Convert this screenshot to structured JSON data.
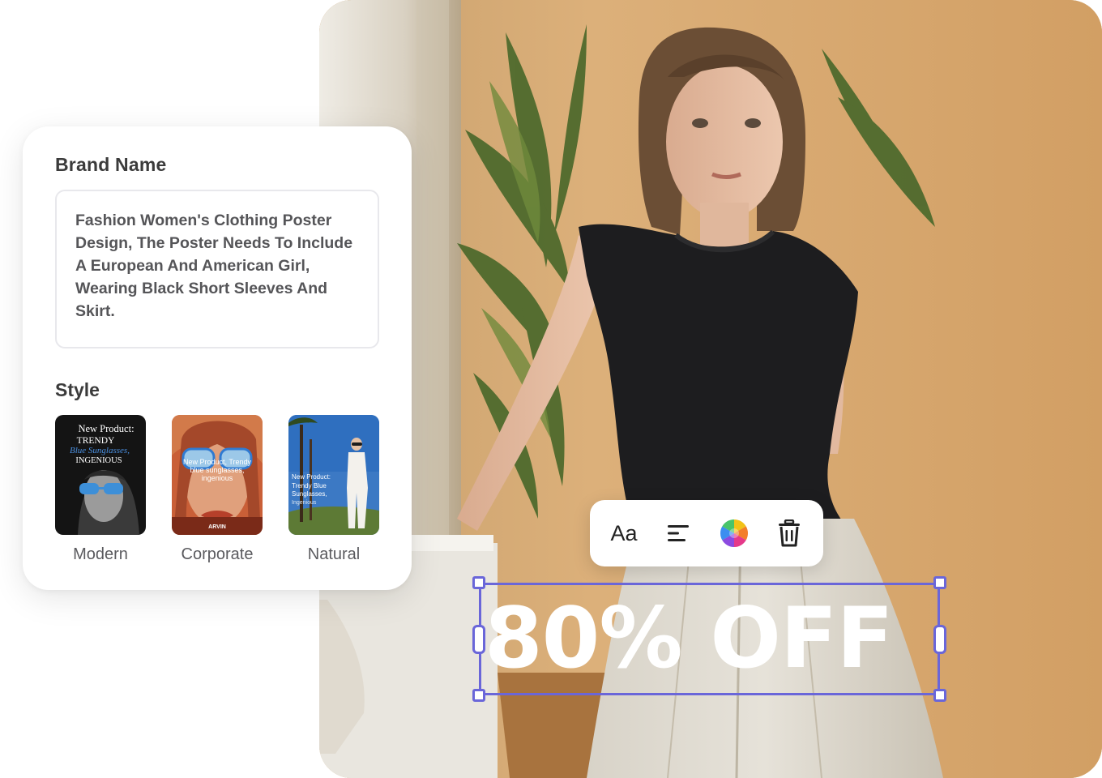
{
  "form": {
    "brand_title": "Brand Name",
    "prompt_text": "Fashion Women's Clothing Poster Design, The Poster Needs To Include A European And American Girl, Wearing Black Short Sleeves And Skirt.",
    "style_title": "Style",
    "styles": [
      {
        "label": "Modern",
        "poster_lines": [
          "New Product:",
          "TRENDY",
          "Blue Sunglasses,",
          "INGENIOUS"
        ]
      },
      {
        "label": "Corporate",
        "poster_lines": [
          "New Product, Trendy",
          "blue sunglasses,",
          "ingenious"
        ],
        "poster_brand": "ARVIN"
      },
      {
        "label": "Natural",
        "poster_lines": [
          "New Product:",
          "Trendy Blue",
          "Sunglasses,",
          "Ingenious"
        ]
      }
    ]
  },
  "toolbar": {
    "font_label": "Aa",
    "icons": [
      "font-icon",
      "align-left-icon",
      "color-wheel-icon",
      "trash-icon"
    ]
  },
  "canvas": {
    "sale_text": "80% OFF",
    "selection_color": "#6a66d9"
  },
  "colors": {
    "accent": "#6a66d9",
    "card_text": "#3b3b3b"
  }
}
